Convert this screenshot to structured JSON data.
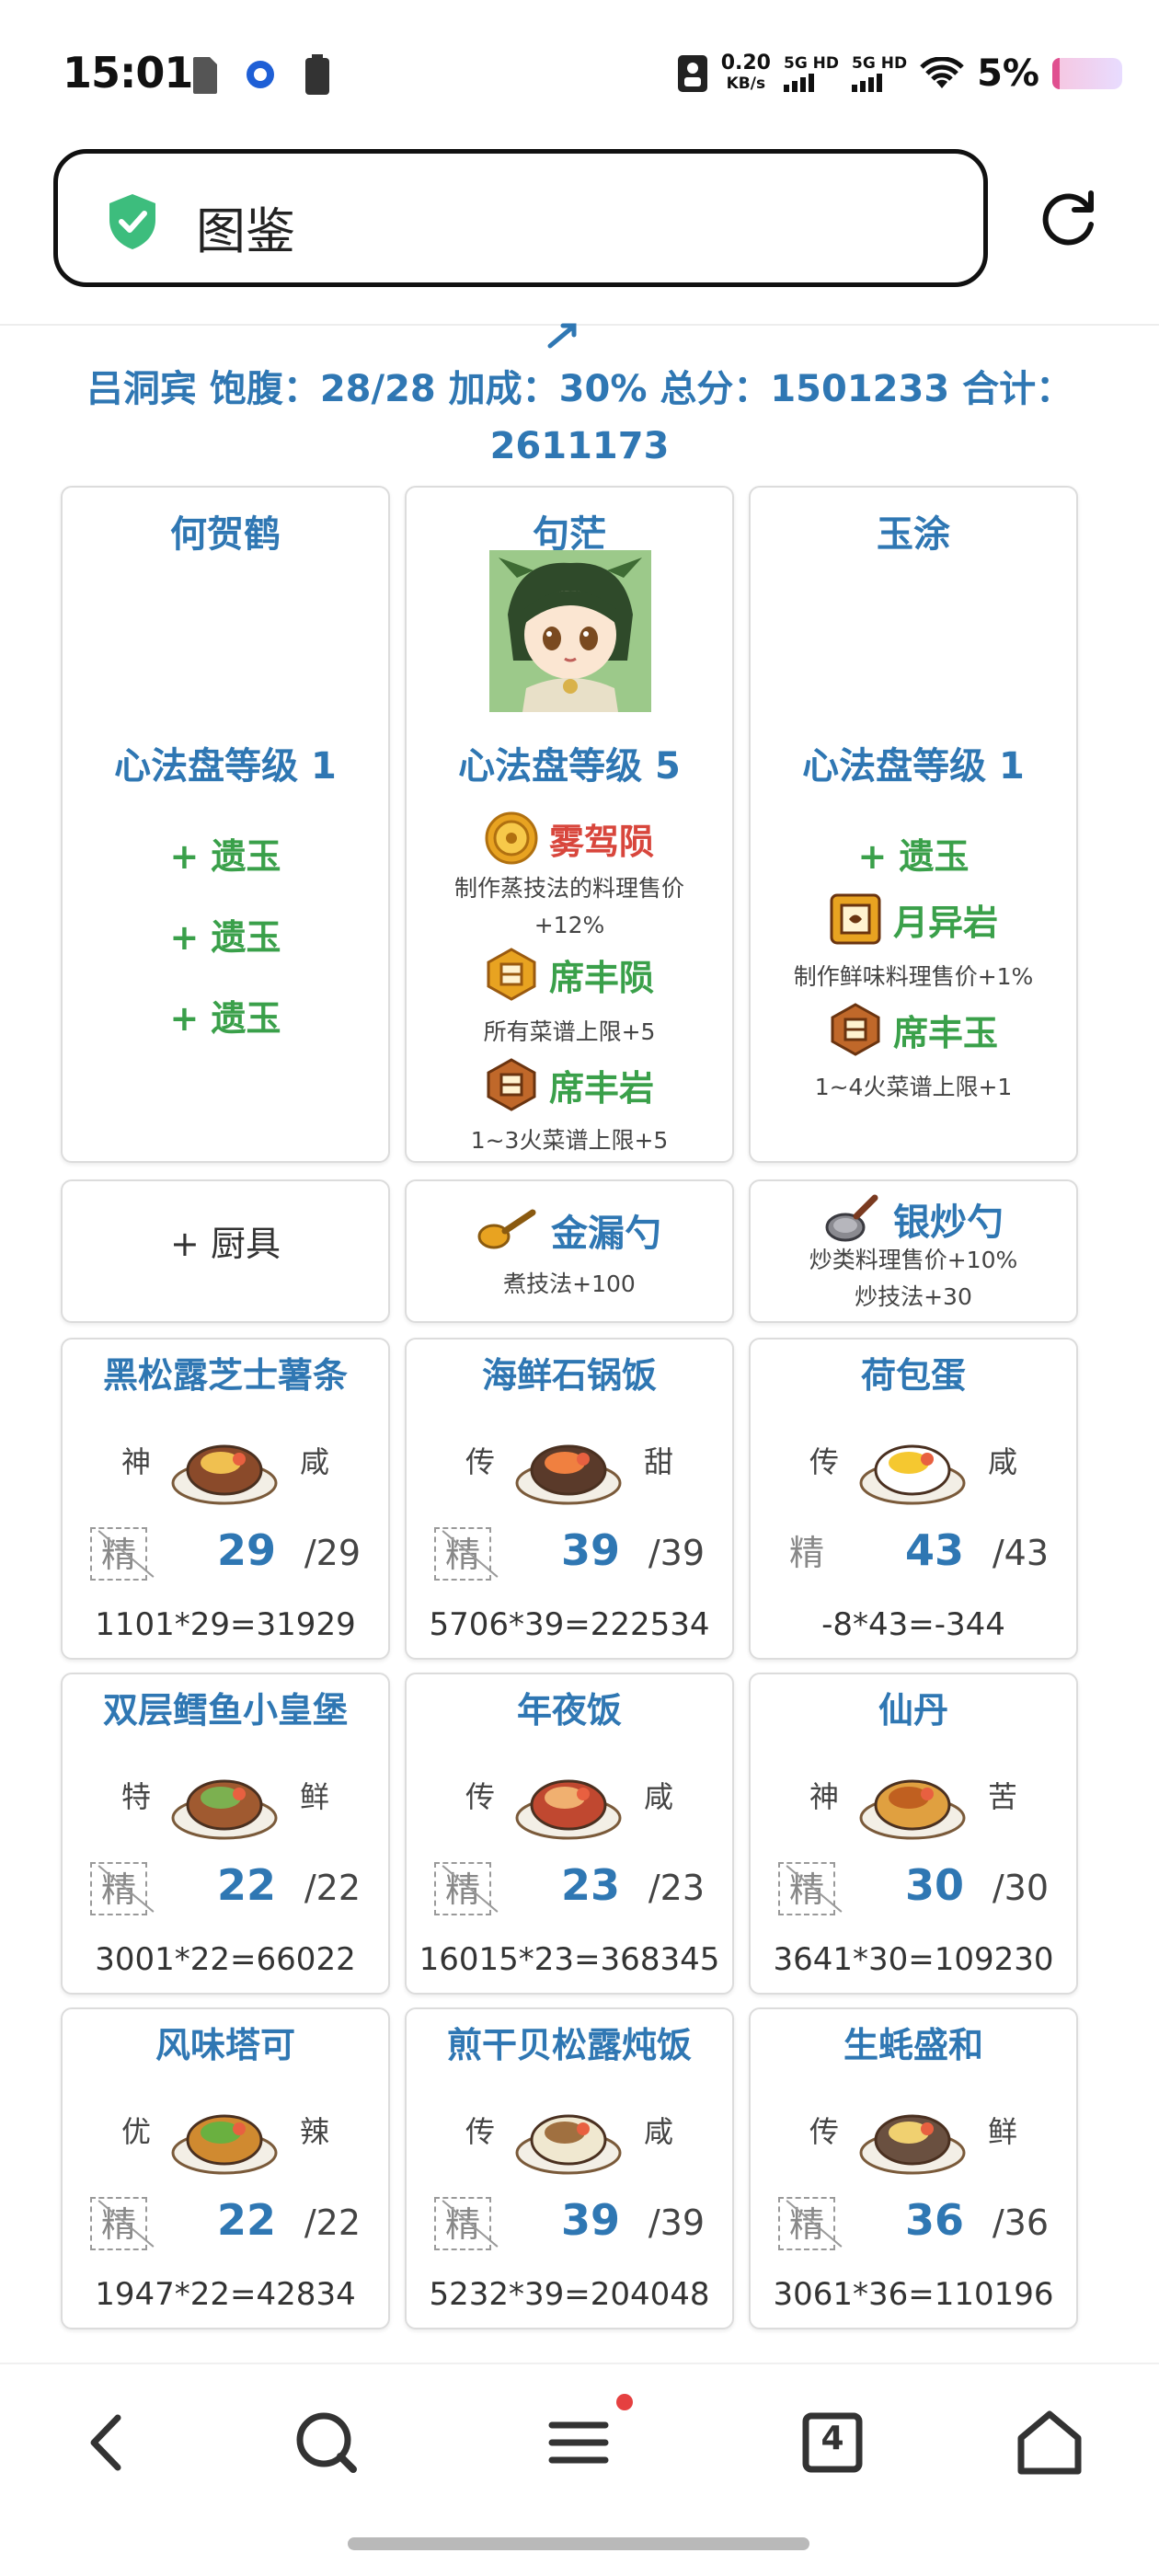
{
  "status_bar": {
    "time": "15:01",
    "net_speed": "0.20",
    "net_unit": "KB/s",
    "sim1_label": "5G HD",
    "sim2_label": "5G HD",
    "battery_percent": "5%"
  },
  "search": {
    "text": "图鉴"
  },
  "summary": {
    "line": "吕洞宾 饱腹：28/28 加成：30% 总分：1501233 合计：2611173"
  },
  "chefs": [
    {
      "name": "何贺鹤",
      "level": "心法盘等级 1",
      "slots": [
        "+ 遗玉",
        "+ 遗玉",
        "+ 遗玉"
      ]
    },
    {
      "name": "句茫",
      "level": "心法盘等级 5",
      "skills": [
        {
          "name": "雾驾陨",
          "desc_line1": "制作蒸技法的料理售价",
          "desc_line2": "+12%",
          "color": "#d8463c"
        },
        {
          "name": "席丰陨",
          "desc_line1": "所有菜谱上限+5",
          "color": "#3aa04a"
        },
        {
          "name": "席丰岩",
          "desc_line1": "1~3火菜谱上限+5",
          "color": "#3aa04a"
        }
      ]
    },
    {
      "name": "玉涂",
      "level": "心法盘等级 1",
      "slot": "+ 遗玉",
      "skills": [
        {
          "name": "月异岩",
          "desc_line1": "制作鲜味料理售价+1%",
          "color": "#3aa04a"
        },
        {
          "name": "席丰玉",
          "desc_line1": "1~4火菜谱上限+1",
          "color": "#3aa04a"
        }
      ]
    }
  ],
  "equipment": [
    {
      "label": "+ 厨具"
    },
    {
      "name": "金漏勺",
      "desc_line1": "煮技法+100",
      "icon": "golden-ladle-icon"
    },
    {
      "name": "银炒勺",
      "desc_line1": "炒类料理售价+10%",
      "desc_line2": "炒技法+30",
      "icon": "silver-wok-spoon-icon"
    }
  ],
  "recipes": [
    {
      "name": "黑松露芝士薯条",
      "rarity": "神",
      "flavor": "咸",
      "jing": "精",
      "jing_style": "dashed",
      "qty": "29",
      "max": "/29",
      "formula": "1101*29=31929"
    },
    {
      "name": "海鲜石锅饭",
      "rarity": "传",
      "flavor": "甜",
      "jing": "精",
      "jing_style": "dashed",
      "qty": "39",
      "max": "/39",
      "formula": "5706*39=222534"
    },
    {
      "name": "荷包蛋",
      "rarity": "传",
      "flavor": "咸",
      "jing": "精",
      "jing_style": "plain",
      "qty": "43",
      "max": "/43",
      "formula": "-8*43=-344"
    },
    {
      "name": "双层鳕鱼小皇堡",
      "rarity": "特",
      "flavor": "鲜",
      "jing": "精",
      "jing_style": "dashed",
      "qty": "22",
      "max": "/22",
      "formula": "3001*22=66022"
    },
    {
      "name": "年夜饭",
      "rarity": "传",
      "flavor": "咸",
      "jing": "精",
      "jing_style": "dashed",
      "qty": "23",
      "max": "/23",
      "formula": "16015*23=368345"
    },
    {
      "name": "仙丹",
      "rarity": "神",
      "flavor": "苦",
      "jing": "精",
      "jing_style": "dashed",
      "qty": "30",
      "max": "/30",
      "formula": "3641*30=109230"
    },
    {
      "name": "风味塔可",
      "rarity": "优",
      "flavor": "辣",
      "jing": "精",
      "jing_style": "dashed",
      "qty": "22",
      "max": "/22",
      "formula": "1947*22=42834"
    },
    {
      "name": "煎干贝松露炖饭",
      "rarity": "传",
      "flavor": "咸",
      "jing": "精",
      "jing_style": "dashed",
      "qty": "39",
      "max": "/39",
      "formula": "5232*39=204048"
    },
    {
      "name": "生蚝盛和",
      "rarity": "传",
      "flavor": "鲜",
      "jing": "精",
      "jing_style": "dashed",
      "qty": "36",
      "max": "/36",
      "formula": "3061*36=110196"
    }
  ],
  "nav": {
    "tab_count": "4",
    "icons": [
      "back-icon",
      "search-icon",
      "menu-icon",
      "tabs-icon",
      "home-icon"
    ]
  },
  "colors": {
    "accent_blue": "#2f77b3",
    "green": "#3aa04a",
    "red": "#d8463c",
    "shield_green": "#3dbd7d"
  }
}
